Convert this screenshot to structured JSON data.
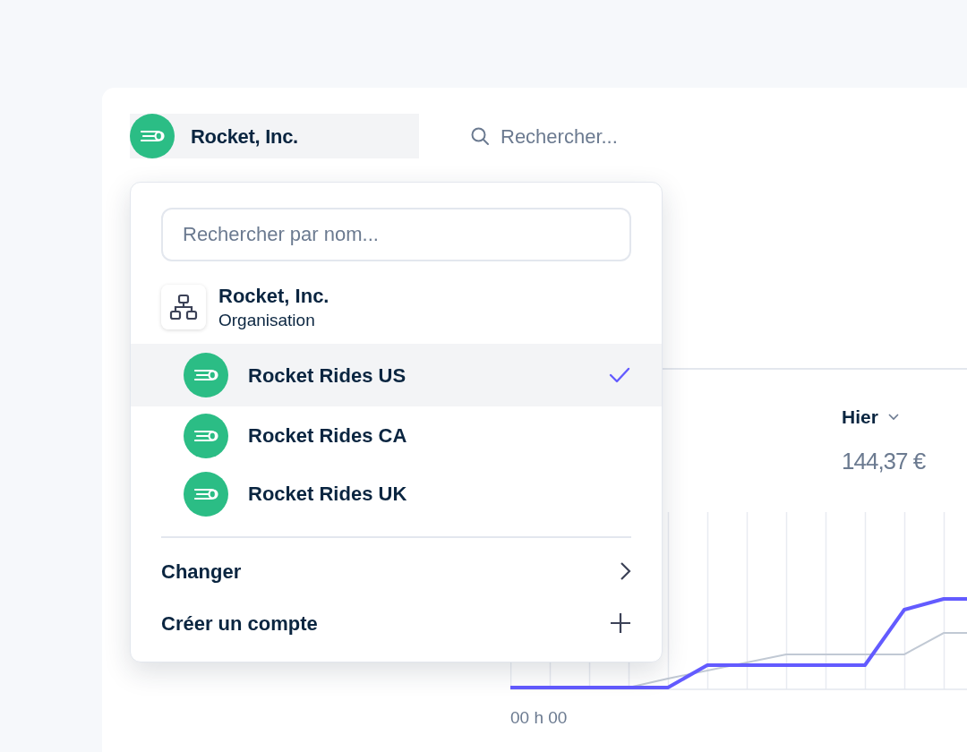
{
  "header": {
    "account": {
      "name": "Rocket, Inc."
    },
    "search": {
      "placeholder": "Rechercher..."
    }
  },
  "dropdown": {
    "search": {
      "placeholder": "Rechercher par nom..."
    },
    "organisation": {
      "name": "Rocket, Inc.",
      "type": "Organisation"
    },
    "accounts": [
      {
        "name": "Rocket Rides US",
        "selected": true
      },
      {
        "name": "Rocket Rides CA",
        "selected": false
      },
      {
        "name": "Rocket Rides UK",
        "selected": false
      }
    ],
    "actions": [
      {
        "label": "Changer",
        "kind": "submenu"
      },
      {
        "label": "Créer un compte",
        "kind": "create"
      }
    ]
  },
  "stats": {
    "period": "Hier",
    "value": "144,37 €"
  },
  "chart": {
    "x_label": "00 h 00"
  }
}
